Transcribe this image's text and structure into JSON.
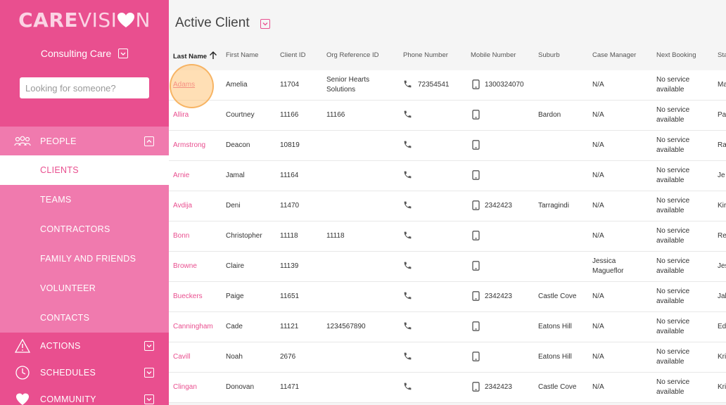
{
  "sidebar": {
    "logo_care": "CARE",
    "logo_vision": "VISI",
    "logo_n": "N",
    "org_name": "Consulting Care",
    "search_placeholder": "Looking for someone?",
    "people": "PEOPLE",
    "items": [
      "CLIENTS",
      "TEAMS",
      "CONTRACTORS",
      "FAMILY AND FRIENDS",
      "VOLUNTEER",
      "CONTACTS"
    ],
    "actions": "ACTIONS",
    "schedules": "SCHEDULES",
    "community": "COMMUNITY"
  },
  "main": {
    "title": "Active Client",
    "columns": [
      "Last Name",
      "First Name",
      "Client ID",
      "Org Reference ID",
      "Phone Number",
      "Mobile Number",
      "Suburb",
      "Case Manager",
      "Next Booking",
      "Sta"
    ],
    "rows": [
      {
        "last": "Adams",
        "first": "Amelia",
        "id": "11704",
        "org": "Senior Hearts Solutions",
        "phone": "72354541",
        "mobile": "1300324070",
        "suburb": "",
        "cm": "N/A",
        "next": "No service available",
        "status": "Ma"
      },
      {
        "last": "Allira",
        "first": "Courtney",
        "id": "11166",
        "org": "11166",
        "phone": "",
        "mobile": "",
        "suburb": "Bardon",
        "cm": "N/A",
        "next": "No service available",
        "status": "Pa"
      },
      {
        "last": "Armstrong",
        "first": "Deacon",
        "id": "10819",
        "org": "",
        "phone": "",
        "mobile": "",
        "suburb": "",
        "cm": "N/A",
        "next": "No service available",
        "status": "Ra"
      },
      {
        "last": "Arnie",
        "first": "Jamal",
        "id": "11164",
        "org": "",
        "phone": "",
        "mobile": "",
        "suburb": "",
        "cm": "N/A",
        "next": "No service available",
        "status": "Je"
      },
      {
        "last": "Avdija",
        "first": "Deni",
        "id": "11470",
        "org": "",
        "phone": "",
        "mobile": "2342423",
        "suburb": "Tarragindi",
        "cm": "N/A",
        "next": "No service available",
        "status": "Kir"
      },
      {
        "last": "Bonn",
        "first": "Christopher",
        "id": "11118",
        "org": "11118",
        "phone": "",
        "mobile": "",
        "suburb": "",
        "cm": "N/A",
        "next": "No service available",
        "status": "Re"
      },
      {
        "last": "Browne",
        "first": "Claire",
        "id": "11139",
        "org": "",
        "phone": "",
        "mobile": "",
        "suburb": "",
        "cm": "Jessica Magueflor",
        "next": "No service available",
        "status": "Jes"
      },
      {
        "last": "Bueckers",
        "first": "Paige",
        "id": "11651",
        "org": "",
        "phone": "",
        "mobile": "2342423",
        "suburb": "Castle Cove",
        "cm": "N/A",
        "next": "No service available",
        "status": "Jal"
      },
      {
        "last": "Canningham",
        "first": "Cade",
        "id": "11121",
        "org": "1234567890",
        "phone": "",
        "mobile": "",
        "suburb": "Eatons Hill",
        "cm": "N/A",
        "next": "No service available",
        "status": "Ed"
      },
      {
        "last": "Cavill",
        "first": "Noah",
        "id": "2676",
        "org": "",
        "phone": "",
        "mobile": "",
        "suburb": "Eatons Hill",
        "cm": "N/A",
        "next": "No service available",
        "status": "Kri"
      },
      {
        "last": "Clingan",
        "first": "Donovan",
        "id": "11471",
        "org": "",
        "phone": "",
        "mobile": "2342423",
        "suburb": "Castle Cove",
        "cm": "N/A",
        "next": "No service available",
        "status": "Kri"
      }
    ]
  },
  "colors": {
    "accent": "#e94f8f",
    "accent_light": "#f07aae"
  }
}
